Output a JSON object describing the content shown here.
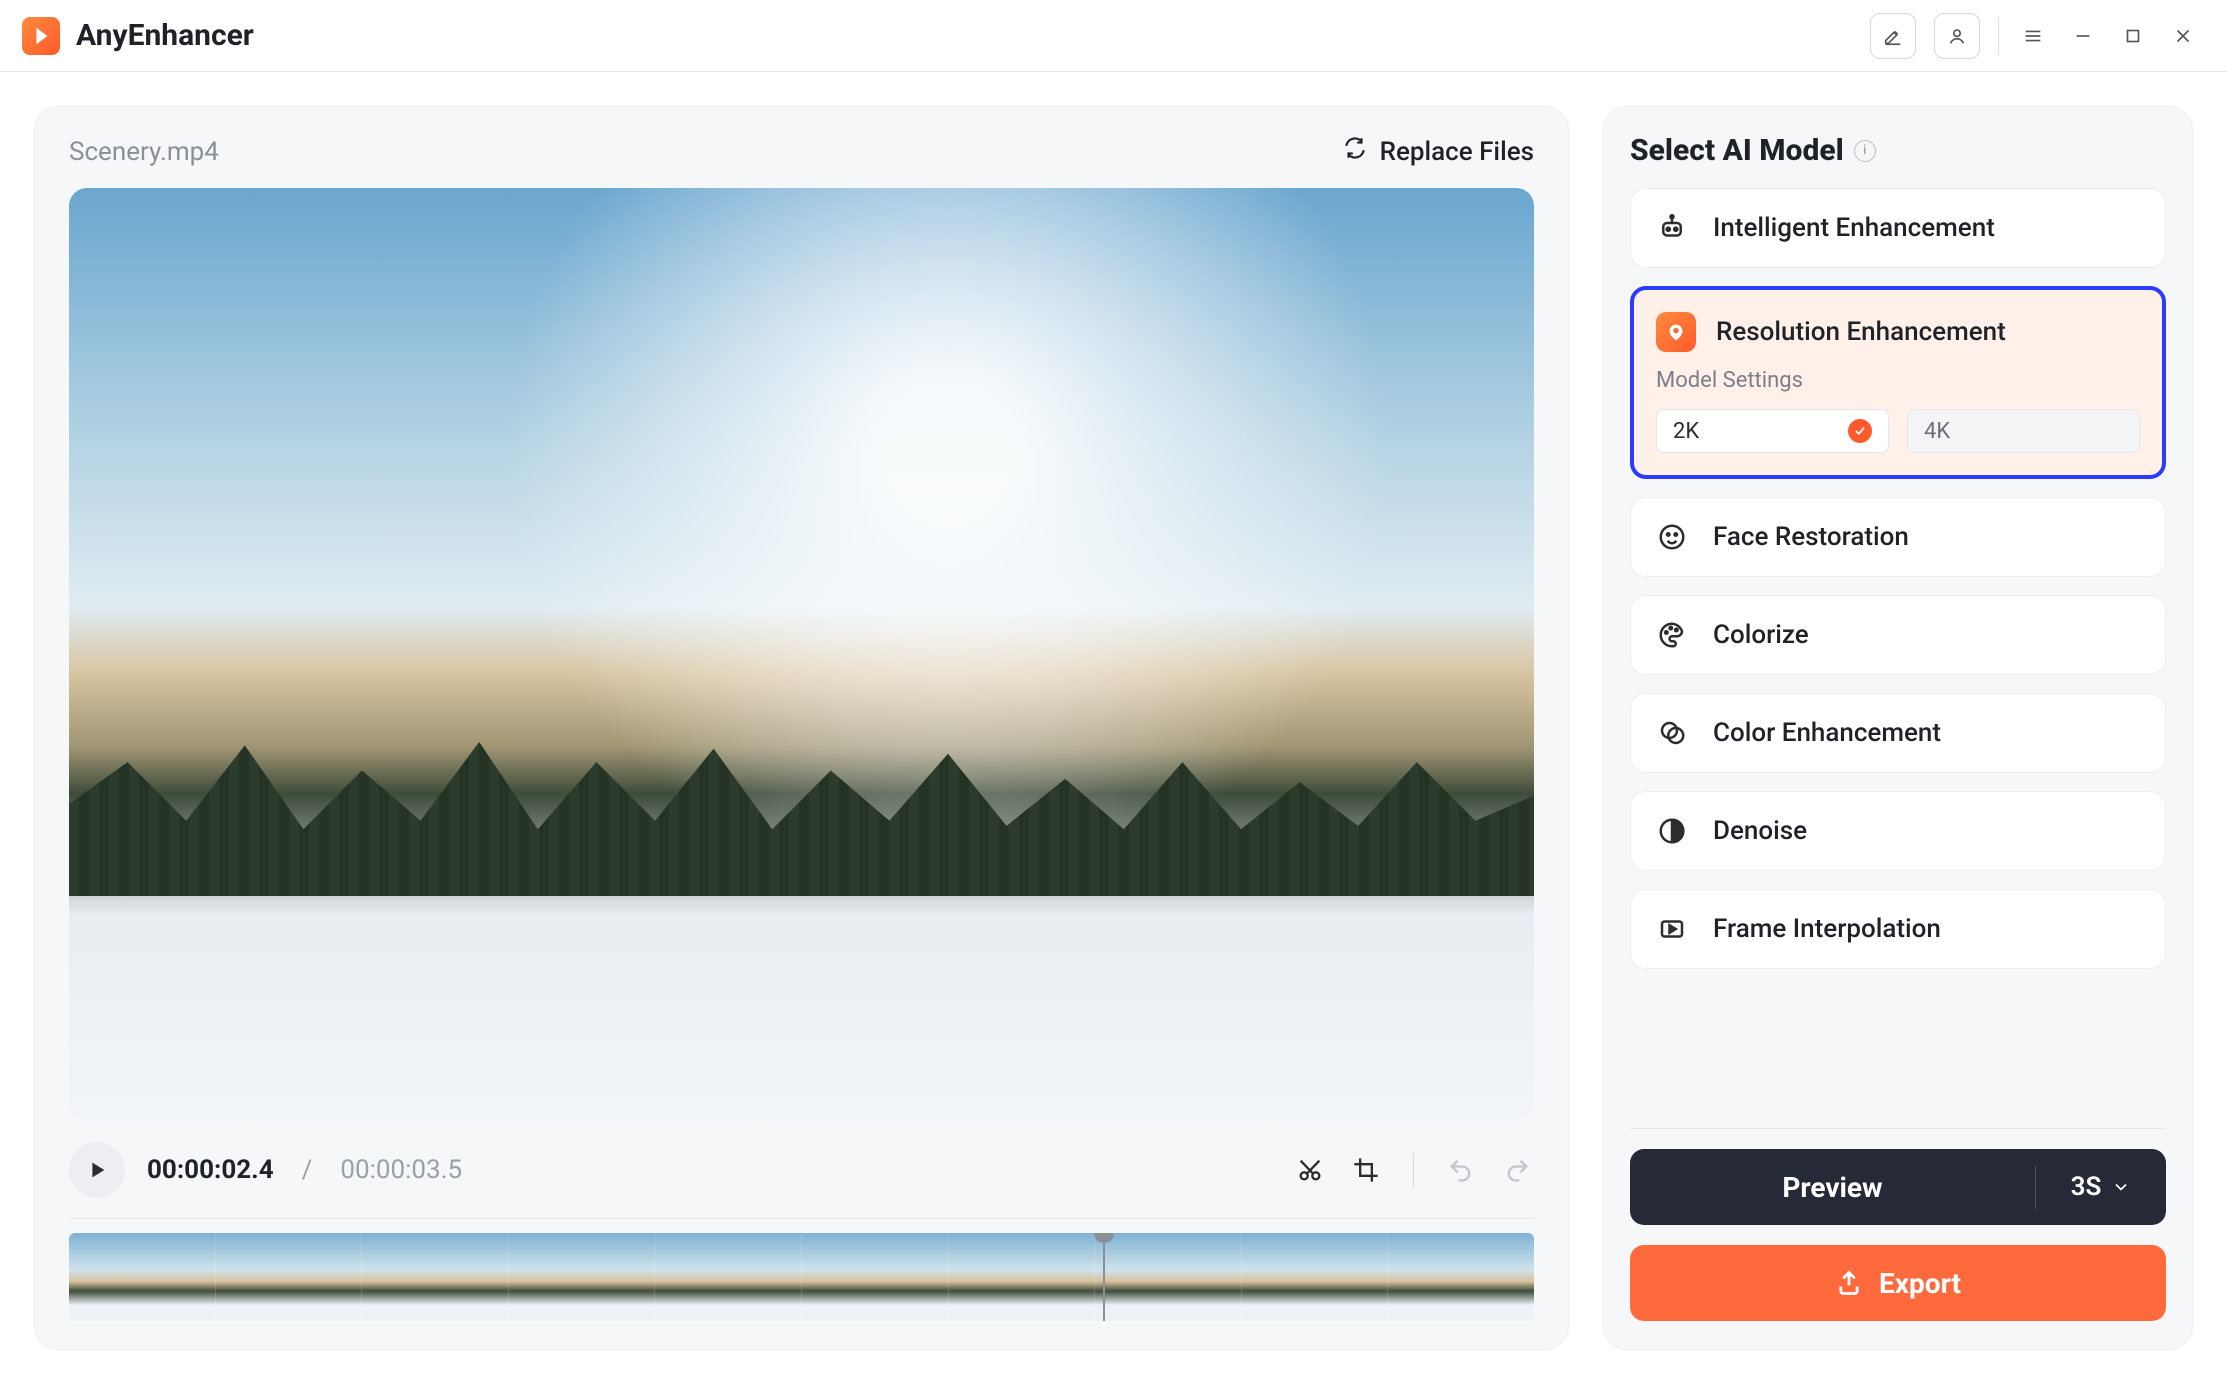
{
  "app": {
    "name": "AnyEnhancer"
  },
  "file": {
    "name": "Scenery.mp4",
    "replace_label": "Replace Files"
  },
  "playback": {
    "current": "00:00:02.4",
    "total": "00:00:03.5",
    "progress": 0.706
  },
  "timeline": {
    "frame_count": 10
  },
  "sidebar": {
    "title": "Select AI Model",
    "models": [
      {
        "key": "intelligent",
        "label": "Intelligent Enhancement"
      },
      {
        "key": "resolution",
        "label": "Resolution Enhancement",
        "selected": true,
        "settings_title": "Model Settings",
        "options": [
          {
            "key": "2k",
            "label": "2K",
            "active": true
          },
          {
            "key": "4k",
            "label": "4K",
            "active": false
          }
        ]
      },
      {
        "key": "face",
        "label": "Face Restoration"
      },
      {
        "key": "colorize",
        "label": "Colorize"
      },
      {
        "key": "colorenh",
        "label": "Color Enhancement"
      },
      {
        "key": "denoise",
        "label": "Denoise"
      },
      {
        "key": "frameint",
        "label": "Frame Interpolation"
      }
    ],
    "preview": {
      "label": "Preview",
      "duration": "3S"
    },
    "export": {
      "label": "Export"
    }
  }
}
